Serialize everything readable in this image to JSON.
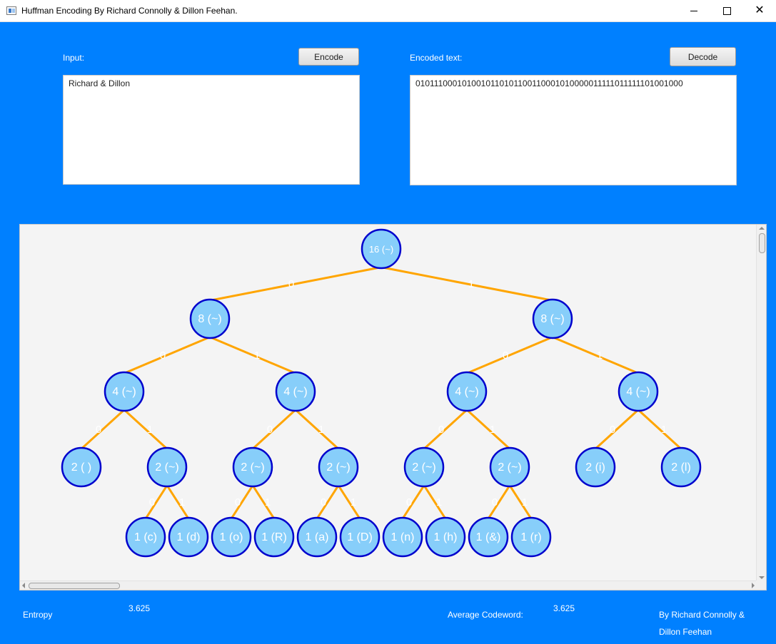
{
  "window": {
    "title": "Huffman Encoding By Richard Connolly & Dillon Feehan.",
    "minimize_icon": "minimize-icon",
    "maximize_icon": "maximize-icon",
    "close_icon": "close-icon",
    "close_glyph": "✕"
  },
  "input": {
    "label": "Input:",
    "encode_button": "Encode",
    "text": "Richard & Dillon"
  },
  "output": {
    "label": "Encoded text:",
    "decode_button": "Decode",
    "text": "0101110001010010110101100110001010000011111011111101001000"
  },
  "tree": {
    "node_fill": "#87cefa",
    "node_stroke": "#0000cd",
    "edge_color": "#ffa500",
    "edge_label_color": "#ffffff",
    "node_text_color": "#ffffff",
    "nodes": [
      {
        "id": "n0",
        "label": "16  (~)"
      },
      {
        "id": "n1",
        "label": "8  (~)"
      },
      {
        "id": "n2",
        "label": "8  (~)"
      },
      {
        "id": "n3",
        "label": "4  (~)"
      },
      {
        "id": "n4",
        "label": "4  (~)"
      },
      {
        "id": "n5",
        "label": "4  (~)"
      },
      {
        "id": "n6",
        "label": "4  (~)"
      },
      {
        "id": "n7",
        "label": "2  ( )"
      },
      {
        "id": "n8",
        "label": "2  (~)"
      },
      {
        "id": "n9",
        "label": "2  (~)"
      },
      {
        "id": "n10",
        "label": "2  (~)"
      },
      {
        "id": "n11",
        "label": "2  (~)"
      },
      {
        "id": "n12",
        "label": "2  (~)"
      },
      {
        "id": "n13",
        "label": "2  (i)"
      },
      {
        "id": "n14",
        "label": "2  (l)"
      },
      {
        "id": "n15",
        "label": "1  (c)"
      },
      {
        "id": "n16",
        "label": "1  (d)"
      },
      {
        "id": "n17",
        "label": "1  (o)"
      },
      {
        "id": "n18",
        "label": "1  (R)"
      },
      {
        "id": "n19",
        "label": "1  (a)"
      },
      {
        "id": "n20",
        "label": "1  (D)"
      },
      {
        "id": "n21",
        "label": "1  (n)"
      },
      {
        "id": "n22",
        "label": "1  (h)"
      },
      {
        "id": "n23",
        "label": "1  (&)"
      },
      {
        "id": "n24",
        "label": "1  (r)"
      }
    ],
    "edges": [
      {
        "from": "n0",
        "to": "n1",
        "label": "0"
      },
      {
        "from": "n0",
        "to": "n2",
        "label": "1"
      },
      {
        "from": "n1",
        "to": "n3",
        "label": "0"
      },
      {
        "from": "n1",
        "to": "n4",
        "label": "1"
      },
      {
        "from": "n2",
        "to": "n5",
        "label": "0"
      },
      {
        "from": "n2",
        "to": "n6",
        "label": "1"
      },
      {
        "from": "n3",
        "to": "n7",
        "label": "0"
      },
      {
        "from": "n3",
        "to": "n8",
        "label": "1"
      },
      {
        "from": "n4",
        "to": "n9",
        "label": "0"
      },
      {
        "from": "n4",
        "to": "n10",
        "label": "1"
      },
      {
        "from": "n5",
        "to": "n11",
        "label": "0"
      },
      {
        "from": "n5",
        "to": "n12",
        "label": "1"
      },
      {
        "from": "n6",
        "to": "n13",
        "label": "0"
      },
      {
        "from": "n6",
        "to": "n14",
        "label": "1"
      },
      {
        "from": "n8",
        "to": "n15",
        "label": "0"
      },
      {
        "from": "n8",
        "to": "n16",
        "label": "1"
      },
      {
        "from": "n9",
        "to": "n17",
        "label": "0"
      },
      {
        "from": "n9",
        "to": "n18",
        "label": "1"
      },
      {
        "from": "n10",
        "to": "n19",
        "label": "0"
      },
      {
        "from": "n10",
        "to": "n20",
        "label": "1"
      },
      {
        "from": "n11",
        "to": "n21",
        "label": "0"
      },
      {
        "from": "n11",
        "to": "n22",
        "label": "1"
      },
      {
        "from": "n12",
        "to": "n23",
        "label": "0"
      },
      {
        "from": "n12",
        "to": "n24",
        "label": "1"
      }
    ]
  },
  "stats": {
    "entropy_label": "Entropy",
    "entropy_value": "3.625",
    "avg_label": "Average Codeword:",
    "avg_value": "3.625",
    "credit_line1": "By  Richard Connolly &",
    "credit_line2": "Dillon Feehan"
  }
}
